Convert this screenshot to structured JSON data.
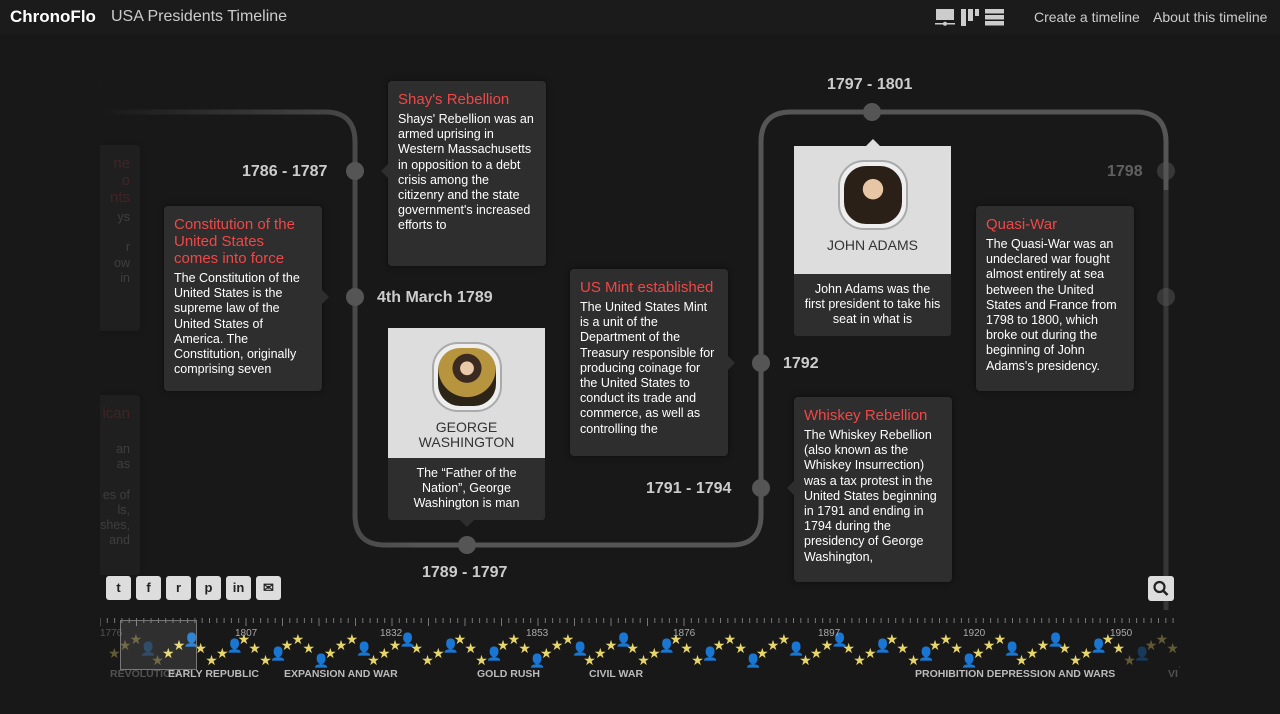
{
  "header": {
    "brand": "ChronoFlo",
    "title": "USA Presidents Timeline",
    "nav": [
      "Create a timeline",
      "About this timeline"
    ],
    "view_icons": [
      "flow-view-icon",
      "columns-view-icon",
      "list-view-icon"
    ]
  },
  "dates": {
    "d1": "1786 - 1787",
    "d2": "4th March 1789",
    "d3": "1789 - 1797",
    "d4": "1792",
    "d5": "1791 - 1794",
    "d6": "1797 - 1801",
    "d7": "1798",
    "d0": "s"
  },
  "events": [
    {
      "title": "Shay's Rebellion",
      "text": "Shays' Rebellion was an armed uprising in Western Massachusetts in opposition to a debt crisis among the citizenry and the state government's increased efforts to"
    },
    {
      "title": "Constitution of the United States comes into force",
      "text": "The Constitution of the United States is the supreme law of the United States of America. The Constitution, originally comprising seven"
    },
    {
      "title": "US Mint established",
      "text": "The United States Mint is a unit of the Department of the Treasury responsible for producing coinage for the United States to conduct its trade and commerce, as well as controlling the"
    },
    {
      "title": "Whiskey Rebellion",
      "text": "The Whiskey Rebellion (also known as the Whiskey Insurrection) was a tax protest in the United States beginning in 1791 and ending in 1794 during the presidency of George Washington,"
    },
    {
      "title": "Quasi-War",
      "text": "The Quasi-War was an undeclared war fought almost entirely at sea between the United States and France from 1798 to 1800, which broke out during the beginning of John Adams's presidency."
    }
  ],
  "people": [
    {
      "name": "GEORGE WASHINGTON",
      "text": "The “Father of the Nation”, George Washington is man"
    },
    {
      "name": "JOHN ADAMS",
      "text": "John Adams was the first president to take his seat in what is"
    }
  ],
  "faded": {
    "c1_title": "ne\no\nnts",
    "c1_text": "ys\n\nr\now\nin",
    "c2_title": "ican",
    "c2_text": "an\nas\n\nes of\nls,\nshes,\nand"
  },
  "share": [
    {
      "icon": "twitter-icon",
      "g": "t"
    },
    {
      "icon": "facebook-icon",
      "g": "f"
    },
    {
      "icon": "reddit-icon",
      "g": "r"
    },
    {
      "icon": "pinterest-icon",
      "g": "p"
    },
    {
      "icon": "linkedin-icon",
      "g": "in"
    },
    {
      "icon": "email-icon",
      "g": "✉"
    }
  ],
  "navigator": {
    "years": [
      "1776",
      "1807",
      "1832",
      "1853",
      "1876",
      "1897",
      "1920",
      "1950"
    ],
    "eras": [
      "REVOLUTION",
      "EARLY REPUBLIC",
      "EXPANSION AND WAR",
      "GOLD RUSH",
      "CIVIL WAR",
      "PROHIBITION DEPRESSION AND WARS",
      "VI"
    ],
    "colors": {
      "star": "#e8d66a",
      "person": "#aaaaaa"
    }
  },
  "colors": {
    "accent": "#f04747",
    "bg": "#181818",
    "card": "#2e2e2e",
    "path": "#555555"
  }
}
